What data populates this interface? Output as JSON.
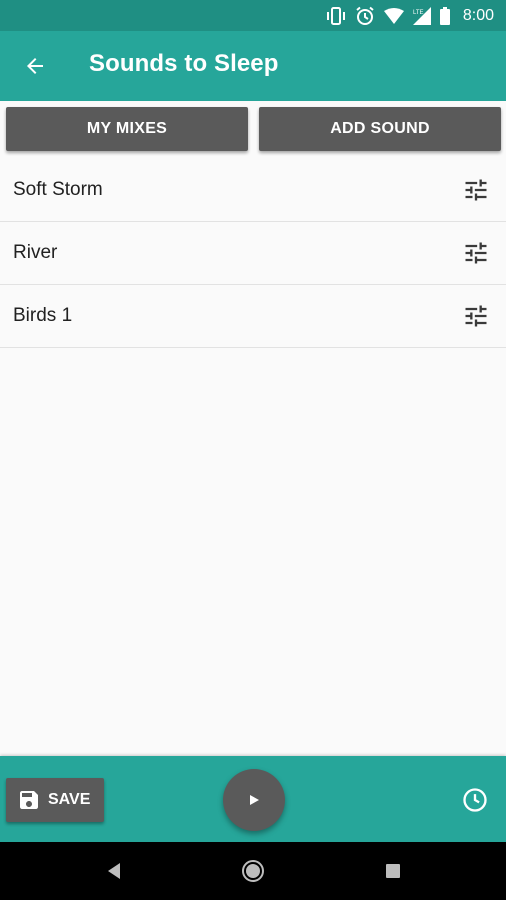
{
  "status_bar": {
    "time": "8:00",
    "icons": [
      "vibrate-icon",
      "alarm-icon",
      "wifi-icon",
      "lte-signal-icon",
      "battery-icon"
    ]
  },
  "app_bar": {
    "title": "Sounds to Sleep",
    "back_icon": "arrow-back-icon"
  },
  "actions": {
    "my_mixes": "MY MIXES",
    "add_sound": "ADD SOUND"
  },
  "sounds": [
    {
      "label": "Soft Storm",
      "icon": "tune-icon"
    },
    {
      "label": "River",
      "icon": "tune-icon"
    },
    {
      "label": "Birds 1",
      "icon": "tune-icon"
    }
  ],
  "bottom_bar": {
    "save_label": "SAVE",
    "play_icon": "play-icon",
    "timer_icon": "clock-icon"
  },
  "nav": {
    "icons": [
      "nav-back-icon",
      "nav-home-icon",
      "nav-recents-icon"
    ]
  },
  "colors": {
    "primary": "#26a69a",
    "primary_dark": "#1f8f83",
    "button": "#5a5a5a",
    "background": "#fafafa"
  }
}
